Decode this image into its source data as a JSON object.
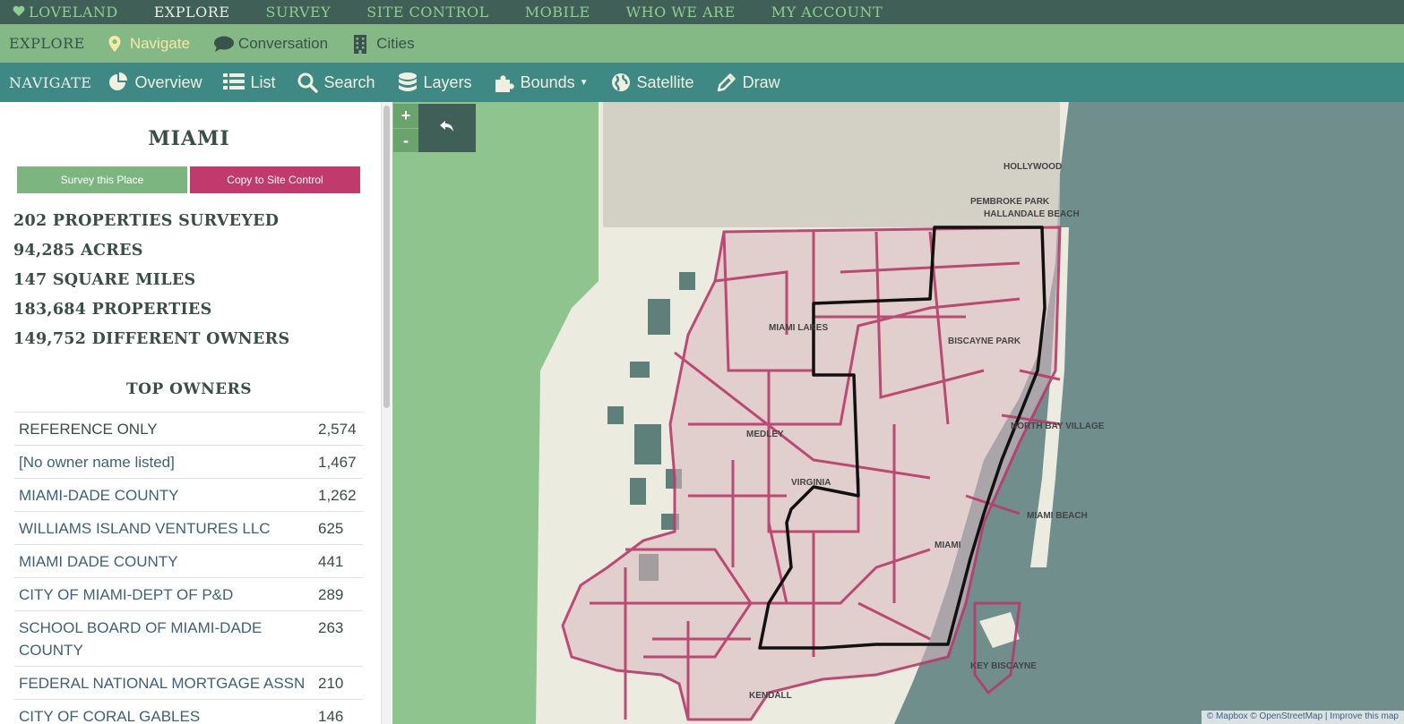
{
  "topnav": {
    "items": [
      "LOVELAND",
      "EXPLORE",
      "SURVEY",
      "SITE CONTROL",
      "MOBILE",
      "WHO WE ARE",
      "MY ACCOUNT"
    ]
  },
  "subnav": {
    "lead": "EXPLORE",
    "items": [
      {
        "label": "Navigate",
        "icon": "map-pin-icon"
      },
      {
        "label": "Conversation",
        "icon": "speech-bubble-icon"
      },
      {
        "label": "Cities",
        "icon": "building-icon"
      }
    ]
  },
  "navbar": {
    "lead": "NAVIGATE",
    "items": [
      {
        "label": "Overview",
        "icon": "pie-chart-icon"
      },
      {
        "label": "List",
        "icon": "list-icon"
      },
      {
        "label": "Search",
        "icon": "search-icon"
      },
      {
        "label": "Layers",
        "icon": "layers-icon"
      },
      {
        "label": "Bounds",
        "icon": "puzzle-icon"
      },
      {
        "label": "Satellite",
        "icon": "globe-icon"
      },
      {
        "label": "Draw",
        "icon": "pencil-icon"
      }
    ]
  },
  "sidebar": {
    "title": "MIAMI",
    "survey_button": "Survey this Place",
    "copy_button": "Copy to Site Control",
    "stats": [
      "202 PROPERTIES SURVEYED",
      "94,285 ACRES",
      "147 SQUARE MILES",
      "183,684 PROPERTIES",
      "149,752 DIFFERENT OWNERS"
    ],
    "owners_title": "TOP OWNERS",
    "owners": [
      {
        "name": "REFERENCE ONLY",
        "count": "2,574"
      },
      {
        "name": "[No owner name listed]",
        "count": "1,467"
      },
      {
        "name": "MIAMI-DADE COUNTY",
        "count": "1,262"
      },
      {
        "name": "WILLIAMS ISLAND VENTURES LLC",
        "count": "625"
      },
      {
        "name": "MIAMI DADE COUNTY",
        "count": "441"
      },
      {
        "name": "CITY OF MIAMI-DEPT OF P&D",
        "count": "289"
      },
      {
        "name": "SCHOOL BOARD OF MIAMI-DADE COUNTY",
        "count": "263"
      },
      {
        "name": "FEDERAL NATIONAL MORTGAGE ASSN",
        "count": "210"
      },
      {
        "name": "CITY OF CORAL GABLES",
        "count": "146"
      }
    ]
  },
  "map": {
    "zoom_in": "+",
    "zoom_out": "-",
    "back_icon": "undo-arrow-icon",
    "attribution": "© Mapbox © OpenStreetMap | Improve this map",
    "labels": [
      "PEMBROKE PARK",
      "HOLLYWOOD",
      "HALLANDALE BEACH",
      "MEDLEY",
      "MIAMI BEACH",
      "KEY BISCAYNE",
      "NORTH BAY VILLAGE",
      "BISCAYNE PARK",
      "VIRGINIA",
      "MIAMI",
      "KENDALL",
      "MIAMI LAKES"
    ],
    "colors": {
      "ocean": "#6f8e8c",
      "land": "#ecebe0",
      "everglades": "#8fc48e",
      "boundary": "#b83a6b",
      "city_line": "#111111"
    }
  }
}
